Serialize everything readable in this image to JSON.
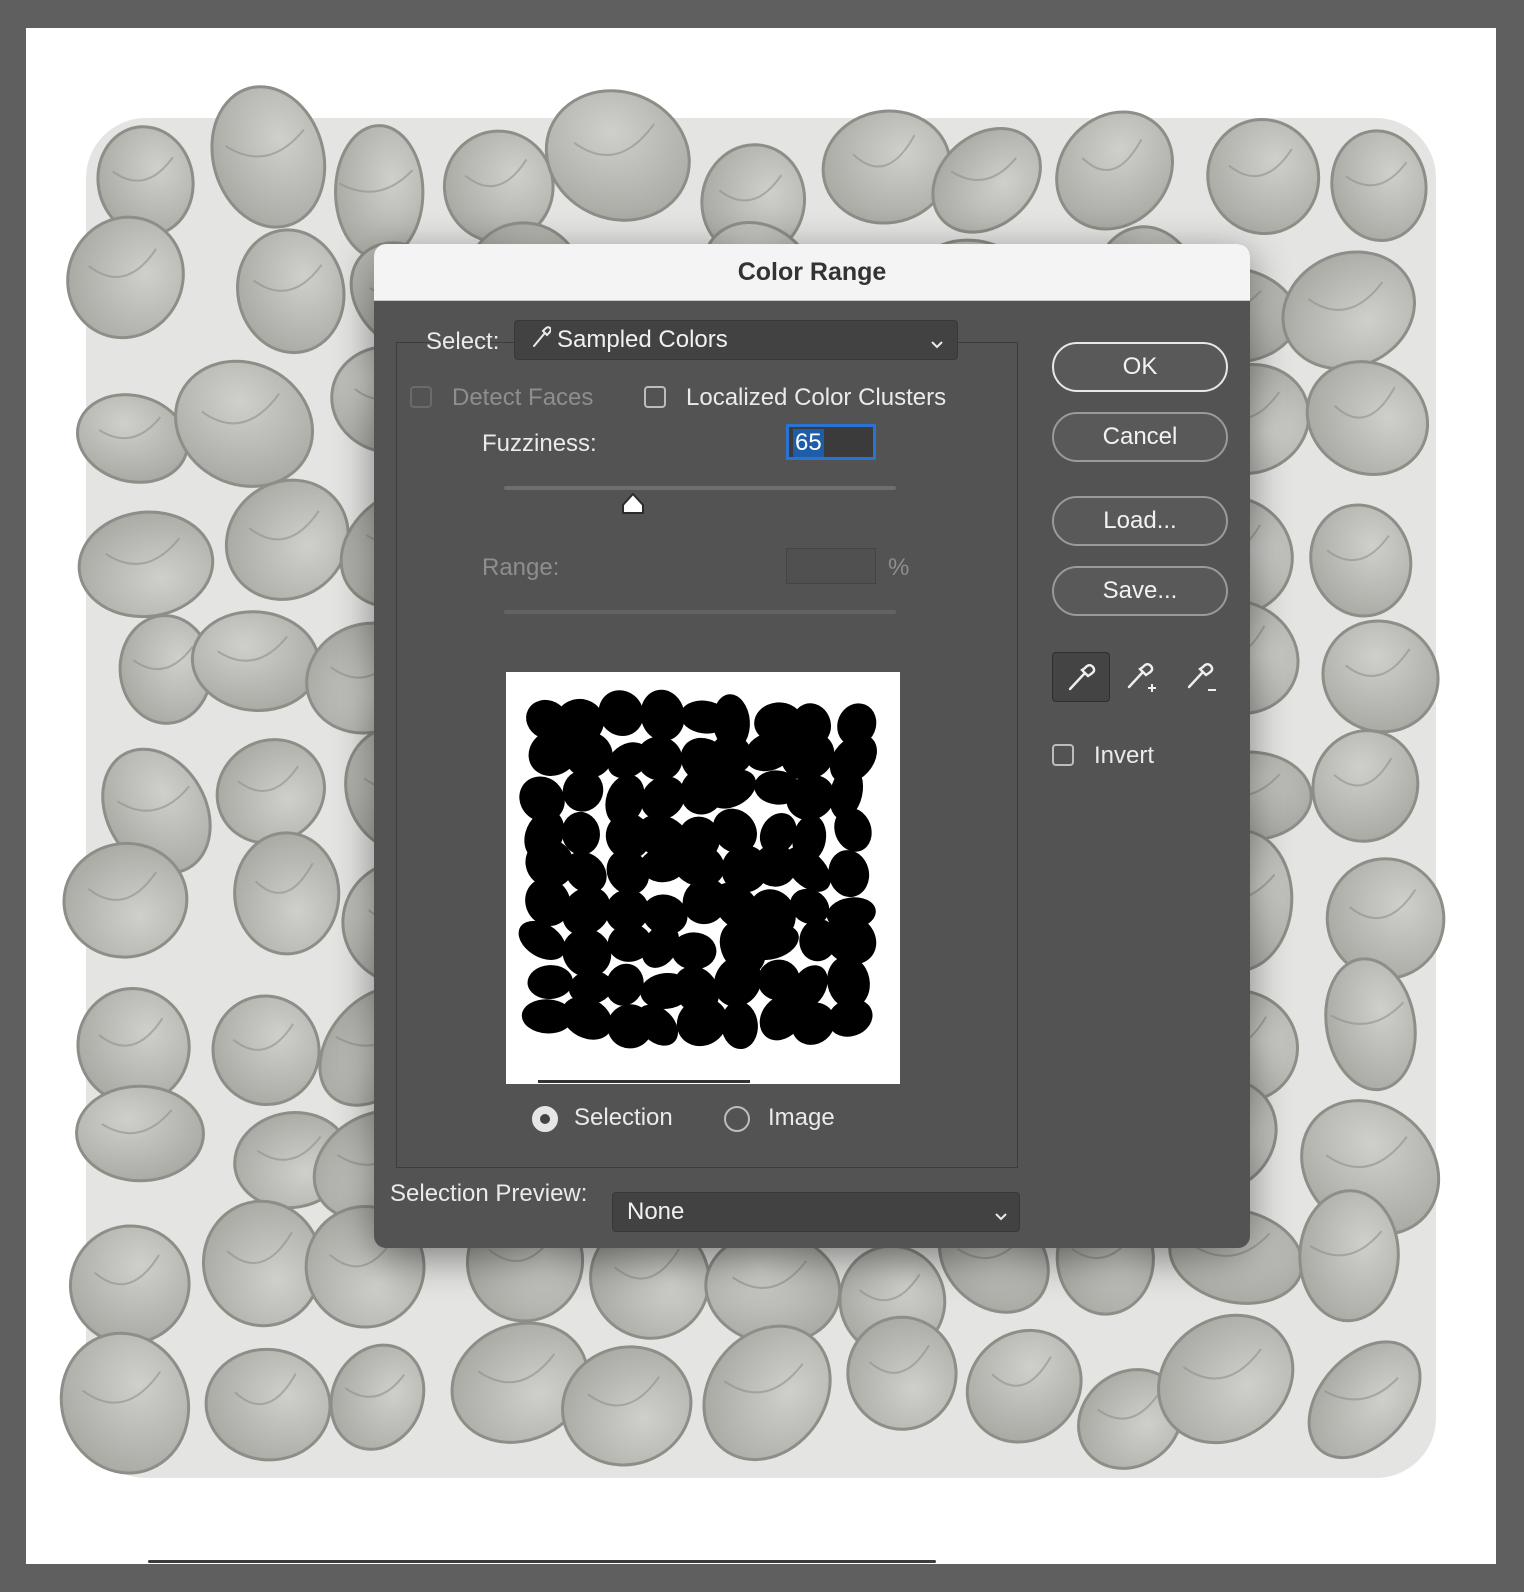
{
  "dialog": {
    "title": "Color Range",
    "select_label": "Select:",
    "select_value": "Sampled Colors",
    "detect_faces_label": "Detect Faces",
    "localized_clusters_label": "Localized Color Clusters",
    "fuzziness_label": "Fuzziness:",
    "fuzziness_value": "65",
    "fuzziness_level_fraction": 0.33,
    "range_label": "Range:",
    "range_value": "",
    "range_unit": "%",
    "view_selection_label": "Selection",
    "view_image_label": "Image",
    "view_selected": "Selection",
    "selection_preview_label": "Selection Preview:",
    "selection_preview_value": "None",
    "buttons": {
      "ok": "OK",
      "cancel": "Cancel",
      "load": "Load...",
      "save": "Save..."
    },
    "tools": [
      "eyedropper-icon",
      "eyedropper-plus-icon",
      "eyedropper-minus-icon"
    ],
    "invert_label": "Invert",
    "colors": {
      "dialog_bg": "#535353",
      "accent": "#2a72d4",
      "canvas_bg": "#5f5f5f"
    }
  }
}
